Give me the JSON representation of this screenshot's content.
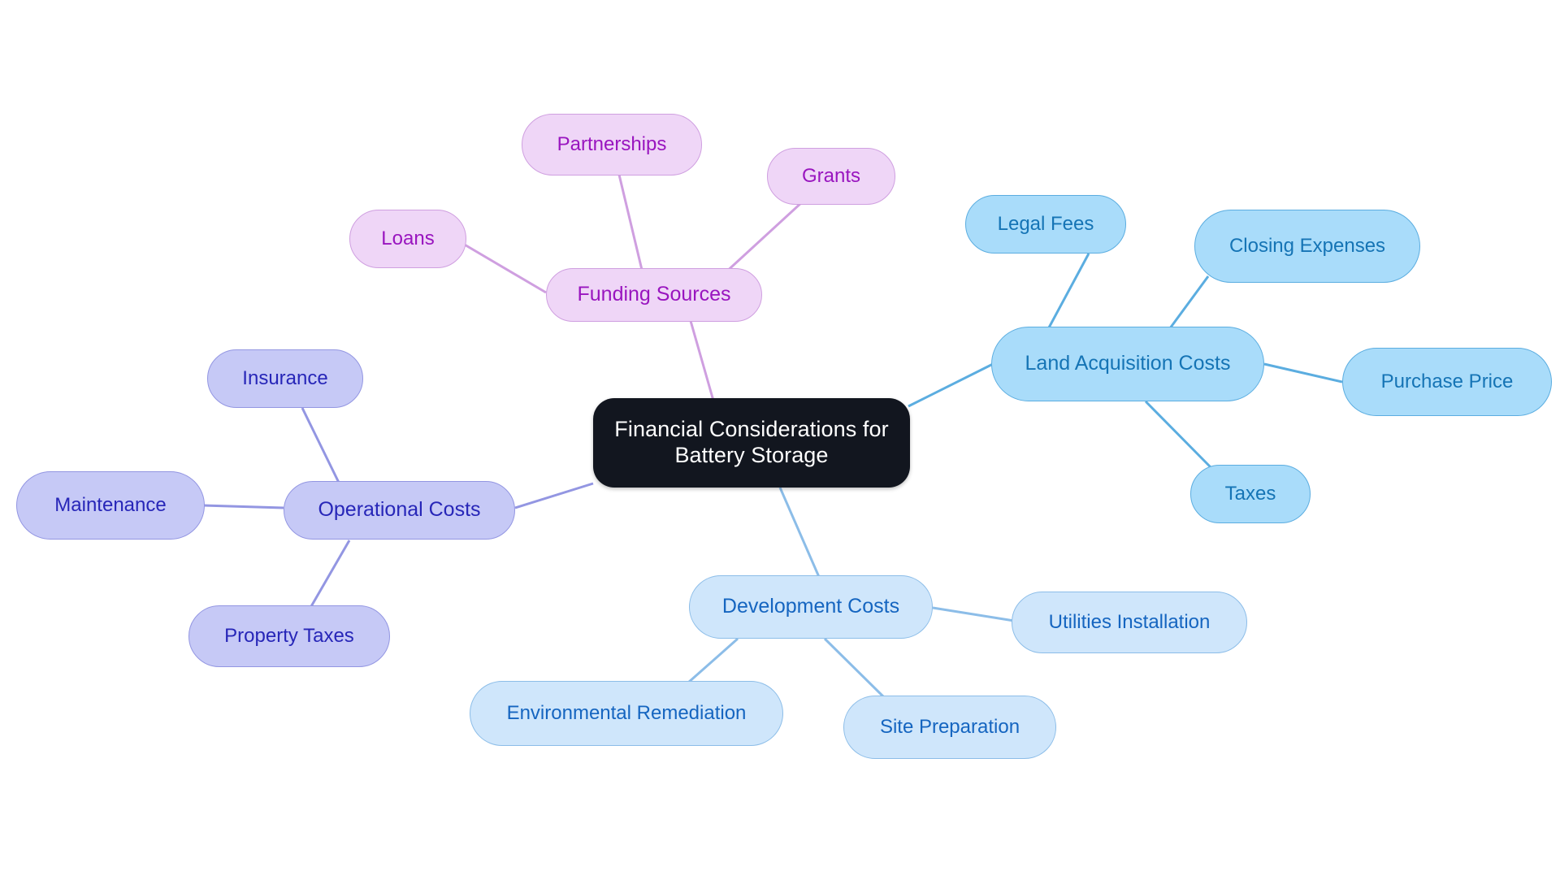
{
  "diagram": {
    "type": "mindmap",
    "title": "Financial Considerations for Battery Storage",
    "background_color": "#ffffff"
  },
  "root": {
    "label": "Financial Considerations for\nBattery Storage",
    "fill": "#12161f",
    "text_color": "#ffffff"
  },
  "branches": [
    {
      "id": "funding-sources",
      "label": "Funding Sources",
      "fill": "#efd6f7",
      "border": "#cf9fe0",
      "text_color": "#9915bf",
      "children": [
        {
          "id": "partnerships",
          "label": "Partnerships"
        },
        {
          "id": "grants",
          "label": "Grants"
        },
        {
          "id": "loans",
          "label": "Loans"
        }
      ]
    },
    {
      "id": "land-acquisition-costs",
      "label": "Land Acquisition Costs",
      "fill": "#a9dcfa",
      "border": "#5bade0",
      "text_color": "#1574b5",
      "children": [
        {
          "id": "legal-fees",
          "label": "Legal Fees"
        },
        {
          "id": "closing-expenses",
          "label": "Closing Expenses"
        },
        {
          "id": "purchase-price",
          "label": "Purchase Price"
        },
        {
          "id": "taxes",
          "label": "Taxes"
        }
      ]
    },
    {
      "id": "development-costs",
      "label": "Development Costs",
      "fill": "#cfe6fb",
      "border": "#8cbde8",
      "text_color": "#1565c0",
      "children": [
        {
          "id": "utilities-installation",
          "label": "Utilities Installation"
        },
        {
          "id": "environmental-remediation",
          "label": "Environmental Remediation"
        },
        {
          "id": "site-preparation",
          "label": "Site Preparation"
        }
      ]
    },
    {
      "id": "operational-costs",
      "label": "Operational Costs",
      "fill": "#c6c9f6",
      "border": "#9396e2",
      "text_color": "#2726b8",
      "children": [
        {
          "id": "insurance",
          "label": "Insurance"
        },
        {
          "id": "maintenance",
          "label": "Maintenance"
        },
        {
          "id": "property-taxes",
          "label": "Property Taxes"
        }
      ]
    }
  ],
  "nodes": {
    "root": {
      "label": "Financial Considerations for\nBattery Storage"
    },
    "funding_sources": {
      "label": "Funding Sources"
    },
    "partnerships": {
      "label": "Partnerships"
    },
    "grants": {
      "label": "Grants"
    },
    "loans": {
      "label": "Loans"
    },
    "land_acquisition_costs": {
      "label": "Land Acquisition Costs"
    },
    "legal_fees": {
      "label": "Legal Fees"
    },
    "closing_expenses": {
      "label": "Closing Expenses"
    },
    "purchase_price": {
      "label": "Purchase Price"
    },
    "taxes": {
      "label": "Taxes"
    },
    "development_costs": {
      "label": "Development Costs"
    },
    "utilities_installation": {
      "label": "Utilities Installation"
    },
    "environmental_remediation": {
      "label": "Environmental Remediation"
    },
    "site_preparation": {
      "label": "Site Preparation"
    },
    "operational_costs": {
      "label": "Operational Costs"
    },
    "insurance": {
      "label": "Insurance"
    },
    "maintenance": {
      "label": "Maintenance"
    },
    "property_taxes": {
      "label": "Property Taxes"
    }
  },
  "edges": [
    {
      "from": "root",
      "to": "funding_sources",
      "color": "#cf9fe0"
    },
    {
      "from": "root",
      "to": "land_acquisition_costs",
      "color": "#5bade0"
    },
    {
      "from": "root",
      "to": "development_costs",
      "color": "#8cbde8"
    },
    {
      "from": "root",
      "to": "operational_costs",
      "color": "#9396e2"
    },
    {
      "from": "funding_sources",
      "to": "partnerships",
      "color": "#cf9fe0"
    },
    {
      "from": "funding_sources",
      "to": "grants",
      "color": "#cf9fe0"
    },
    {
      "from": "funding_sources",
      "to": "loans",
      "color": "#cf9fe0"
    },
    {
      "from": "land_acquisition_costs",
      "to": "legal_fees",
      "color": "#5bade0"
    },
    {
      "from": "land_acquisition_costs",
      "to": "closing_expenses",
      "color": "#5bade0"
    },
    {
      "from": "land_acquisition_costs",
      "to": "purchase_price",
      "color": "#5bade0"
    },
    {
      "from": "land_acquisition_costs",
      "to": "taxes",
      "color": "#5bade0"
    },
    {
      "from": "development_costs",
      "to": "utilities_installation",
      "color": "#8cbde8"
    },
    {
      "from": "development_costs",
      "to": "environmental_remediation",
      "color": "#8cbde8"
    },
    {
      "from": "development_costs",
      "to": "site_preparation",
      "color": "#8cbde8"
    },
    {
      "from": "operational_costs",
      "to": "insurance",
      "color": "#9396e2"
    },
    {
      "from": "operational_costs",
      "to": "maintenance",
      "color": "#9396e2"
    },
    {
      "from": "operational_costs",
      "to": "property_taxes",
      "color": "#9396e2"
    }
  ]
}
